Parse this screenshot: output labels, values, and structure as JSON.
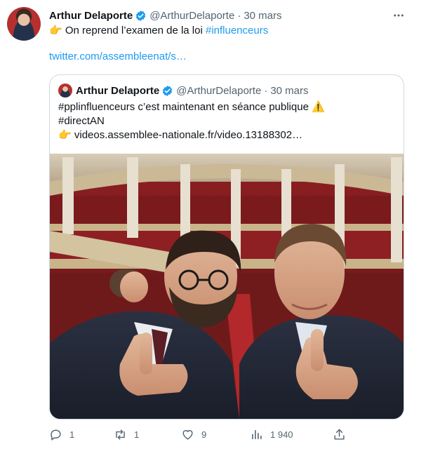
{
  "tweet": {
    "author_name": "Arthur Delaporte",
    "author_handle": "@ArthurDelaporte",
    "separator": "·",
    "date": "30 mars",
    "text_emoji": "👉",
    "text_prefix": "On reprend l’examen de la loi ",
    "text_hashtag": "#influenceurs",
    "link": "twitter.com/assembleenat/s…"
  },
  "quote": {
    "author_name": "Arthur Delaporte",
    "author_handle": "@ArthurDelaporte",
    "separator": "·",
    "date": "30 mars",
    "line1": "#pplinfluenceurs c’est maintenant en séance publique ⚠️",
    "line2": "#directAN",
    "line3_emoji": "👉",
    "line3_link": "videos.assemblee-nationale.fr/video.13188302…"
  },
  "actions": {
    "replies": "1",
    "retweets": "1",
    "likes": "9",
    "views": "1 940"
  },
  "icons": {
    "verified": "verified-badge-icon",
    "more": "more-options-icon",
    "reply": "reply-icon",
    "retweet": "retweet-icon",
    "like": "heart-icon",
    "views": "views-chart-icon",
    "share": "share-icon"
  },
  "colors": {
    "accent": "#1d9bf0",
    "muted": "#536471",
    "border": "#cfd9de",
    "text": "#0f1419"
  }
}
